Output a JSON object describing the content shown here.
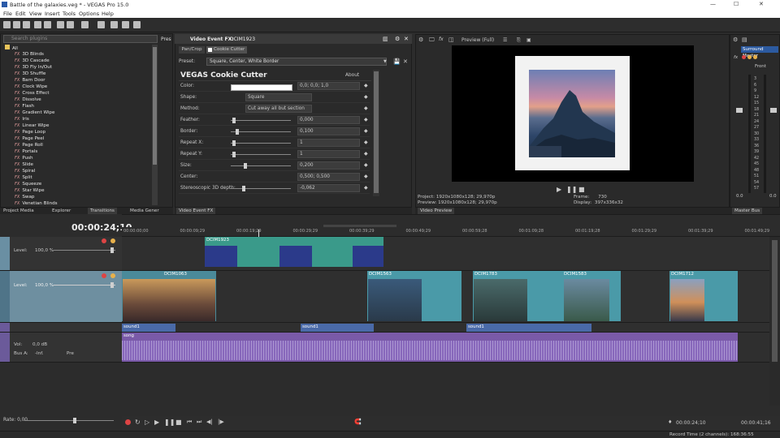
{
  "window": {
    "title": "Battle of the galaxies.veg * - VEGAS Pro 15.0",
    "controls": {
      "minimize": "—",
      "maximize": "☐",
      "close": "✕"
    }
  },
  "menu": [
    "File",
    "Edit",
    "View",
    "Insert",
    "Tools",
    "Options",
    "Help"
  ],
  "plugins": {
    "search_placeholder": "Search plugins",
    "pres_label": "Pres",
    "root": "All",
    "items": [
      "3D Blinds",
      "3D Cascade",
      "3D Fly In/Out",
      "3D Shuffle",
      "Barn Door",
      "Clock Wipe",
      "Cross Effect",
      "Dissolve",
      "Flash",
      "Gradient Wipe",
      "Iris",
      "Linear Wipe",
      "Page Loop",
      "Page Peel",
      "Page Roll",
      "Portals",
      "Push",
      "Slide",
      "Spiral",
      "Split",
      "Squeeze",
      "Star Wipe",
      "Swap",
      "Venetian Blinds"
    ]
  },
  "left_tabs": [
    "Project Media",
    "Explorer",
    "Transitions",
    "Media Gener"
  ],
  "event_fx": {
    "title": "Video Event FX:",
    "clip": "DCIM1923",
    "chain": [
      "Pan/Crop",
      "Cookie Cutter"
    ],
    "preset_label": "Preset:",
    "preset_value": "Square, Center, White Border",
    "plugin_name": "VEGAS Cookie Cutter",
    "about": "About",
    "params": [
      {
        "label": "Color:",
        "value": "0,0; 0,0; 1,0"
      },
      {
        "label": "Shape:",
        "value": "Square"
      },
      {
        "label": "Method:",
        "value": "Cut away all but section"
      },
      {
        "label": "Feather:",
        "value": "0,000"
      },
      {
        "label": "Border:",
        "value": "0,100"
      },
      {
        "label": "Repeat X:",
        "value": "1"
      },
      {
        "label": "Repeat Y:",
        "value": "1"
      },
      {
        "label": "Size:",
        "value": "0,200"
      },
      {
        "label": "Center:",
        "value": "0,500; 0,500"
      },
      {
        "label": "Stereoscopic 3D depth:",
        "value": "-0,062"
      }
    ],
    "tab": "Video Event FX"
  },
  "preview": {
    "mode": "Preview (Full)",
    "project_label": "Project:",
    "project": "1920x1080x128; 29,970p",
    "preview_label": "Preview:",
    "preview_val": "1920x1080x128; 29,970p",
    "frame_label": "Frame:",
    "frame": "730",
    "display_label": "Display:",
    "display": "397x336x32",
    "tab": "Video Preview"
  },
  "mixer": {
    "title": "Surround Master",
    "front": "Front",
    "scale": [
      "3",
      "6",
      "9",
      "12",
      "15",
      "18",
      "21",
      "24",
      "27",
      "30",
      "33",
      "36",
      "39",
      "42",
      "45",
      "48",
      "51",
      "54",
      "57"
    ],
    "left_val": "0.0",
    "right_val": "0.0",
    "tab": "Master Bus"
  },
  "timeline": {
    "timecode": "00:00:24;10",
    "ruler": [
      "00:00:00;00",
      "00:00:09;29",
      "00:00:19;29",
      "00:00:29;29",
      "00:00:39;29",
      "00:00:49;29",
      "00:00:59;28",
      "00:01:09;28",
      "00:01:19;28",
      "00:01:29;29",
      "00:01:39;29",
      "00:01:49;29"
    ],
    "tracks": [
      {
        "level_label": "Level:",
        "level": "100,0 %"
      },
      {
        "level_label": "Level:",
        "level": "100,0 %"
      },
      {
        "vol_label": "Vol:",
        "vol": "0,0 dB",
        "bus_label": "Bus A:",
        "bus": "-Inf.",
        "pre": "Pre"
      }
    ],
    "clips": {
      "fx": "DCIM1923",
      "v1": "DCIM1063",
      "v2": "DCIM1563",
      "v3": "DCIM1783",
      "v4": "DCIM1583",
      "v5": "DCIM1712",
      "a1": "sound1",
      "a2": "sound1",
      "a3": "sound1",
      "music": "song"
    },
    "rate_label": "Rate: 0,00",
    "end_time": "00:00:24;10",
    "frames": "00:00:41;16"
  },
  "status": {
    "record": "Record Time (2 channels): 168:36:55"
  }
}
